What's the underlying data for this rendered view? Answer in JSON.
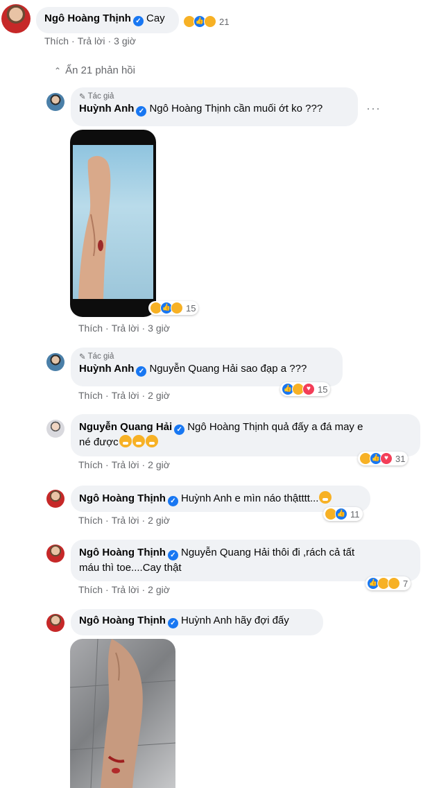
{
  "top_comment": {
    "name": "Ngô Hoàng Thịnh",
    "text": "Cay",
    "reaction_count": "21",
    "actions": {
      "like": "Thích",
      "reply": "Trả lời",
      "time": "3 giờ"
    }
  },
  "hide_replies": {
    "icon": "chevron-up-icon",
    "label": "Ẩn 21 phản hồi"
  },
  "replies": [
    {
      "author_badge": "Tác giả",
      "name": "Huỳnh Anh",
      "mention": "Ngô Hoàng Thịnh",
      "text": " cần muối ớt ko ???",
      "photo_alt": "leg in ice water",
      "reaction_count": "15",
      "actions": {
        "like": "Thích",
        "reply": "Trả lời",
        "time": "3 giờ"
      }
    },
    {
      "author_badge": "Tác giả",
      "name": "Huỳnh Anh",
      "mention": "Nguyễn Quang Hải",
      "text": " sao đạp a ???",
      "reaction_count": "15",
      "actions": {
        "like": "Thích",
        "reply": "Trả lời",
        "time": "2 giờ"
      }
    },
    {
      "name": "Nguyễn Quang Hải",
      "mention": "Ngô Hoàng Thịnh",
      "text": " quả đấy a đá may e",
      "text2": "né được",
      "reaction_count": "31",
      "actions": {
        "like": "Thích",
        "reply": "Trả lời",
        "time": "2 giờ"
      }
    },
    {
      "name": "Ngô Hoàng Thịnh",
      "mention": "Huỳnh Anh",
      "text": " e mìn náo thậtttt...",
      "reaction_count": "11",
      "actions": {
        "like": "Thích",
        "reply": "Trả lời",
        "time": "2 giờ"
      }
    },
    {
      "name": "Ngô Hoàng Thịnh",
      "mention": "Nguyễn Quang Hải",
      "text": " thôi đi ,rách cả tất",
      "text2": "máu thì toe....Cay thật",
      "reaction_count": "7",
      "actions": {
        "like": "Thích",
        "reply": "Trả lời",
        "time": "2 giờ"
      }
    },
    {
      "name": "Ngô Hoàng Thịnh",
      "mention": "Huỳnh Anh",
      "text": " hãy đợi đấy"
    }
  ],
  "colors": {
    "bubble": "#f0f2f5",
    "verified": "#1877f2",
    "meta": "#65676b"
  }
}
